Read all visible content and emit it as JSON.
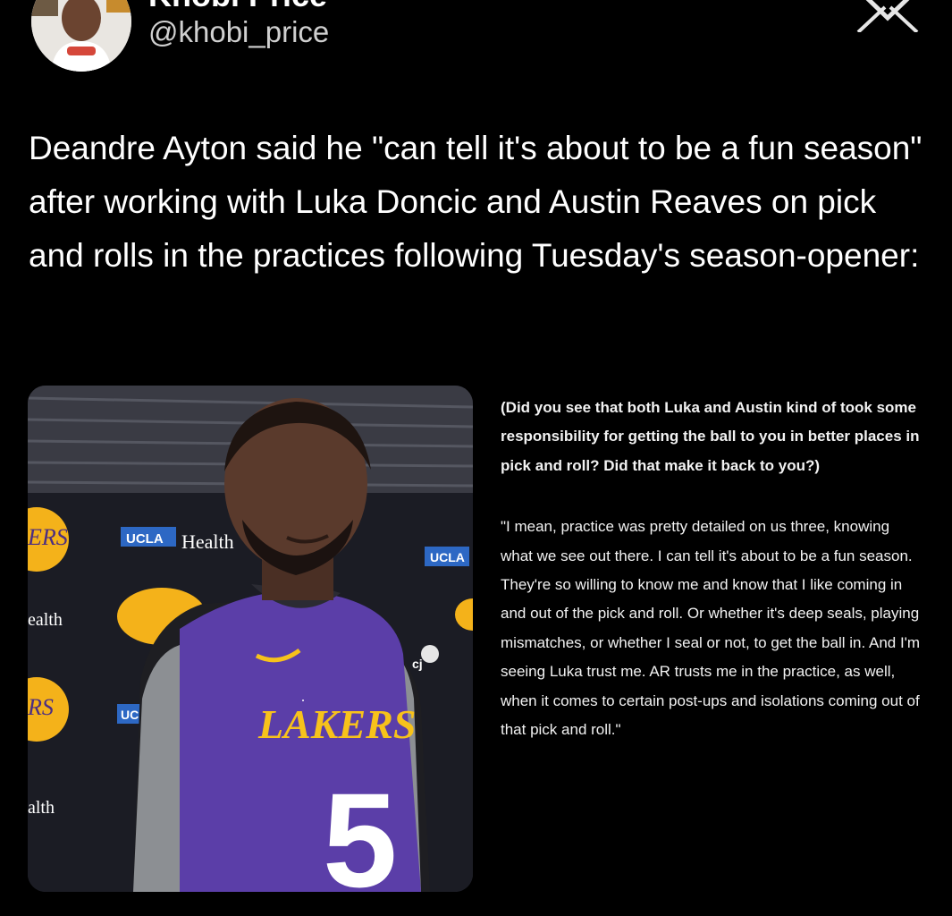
{
  "author": {
    "display_name": "Khobi Price",
    "handle": "@khobi_price"
  },
  "tweet": {
    "text": "Deandre Ayton said he \"can tell it's about to be a fun season\" after working with Luka Doncic and Austin Reaves on pick and rolls in the practices following Tuesday's season-opener:"
  },
  "media": {
    "backdrop_text": [
      "UCLA",
      "Health",
      "ealth",
      "alth",
      "UCLA",
      "UC"
    ],
    "jersey_team": "LAKERS",
    "jersey_number": "5",
    "jersey_sponsor": "cj"
  },
  "transcript": {
    "question": "(Did you see that both Luka and Austin kind of took some responsibility for getting the ball to you in better places in pick and roll? Did that make it back to you?)",
    "answer": "\"I mean, practice was pretty detailed on us three, knowing what we see out there. I can tell it's about to be a fun season. They're so willing to know me and know that I like coming in and out of the pick and roll. Or whether it's deep seals, playing mismatches, or whether I seal or not, to get the ball in. And I'm seeing Luka trust me. AR trusts me in the practice, as well, when it comes to certain post-ups and isolations coming out of that pick and roll.\""
  },
  "colors": {
    "background": "#000000",
    "jersey_purple": "#5b3ea8",
    "lakers_gold": "#f7c21b"
  },
  "icons": {
    "platform": "x-logo-icon"
  }
}
